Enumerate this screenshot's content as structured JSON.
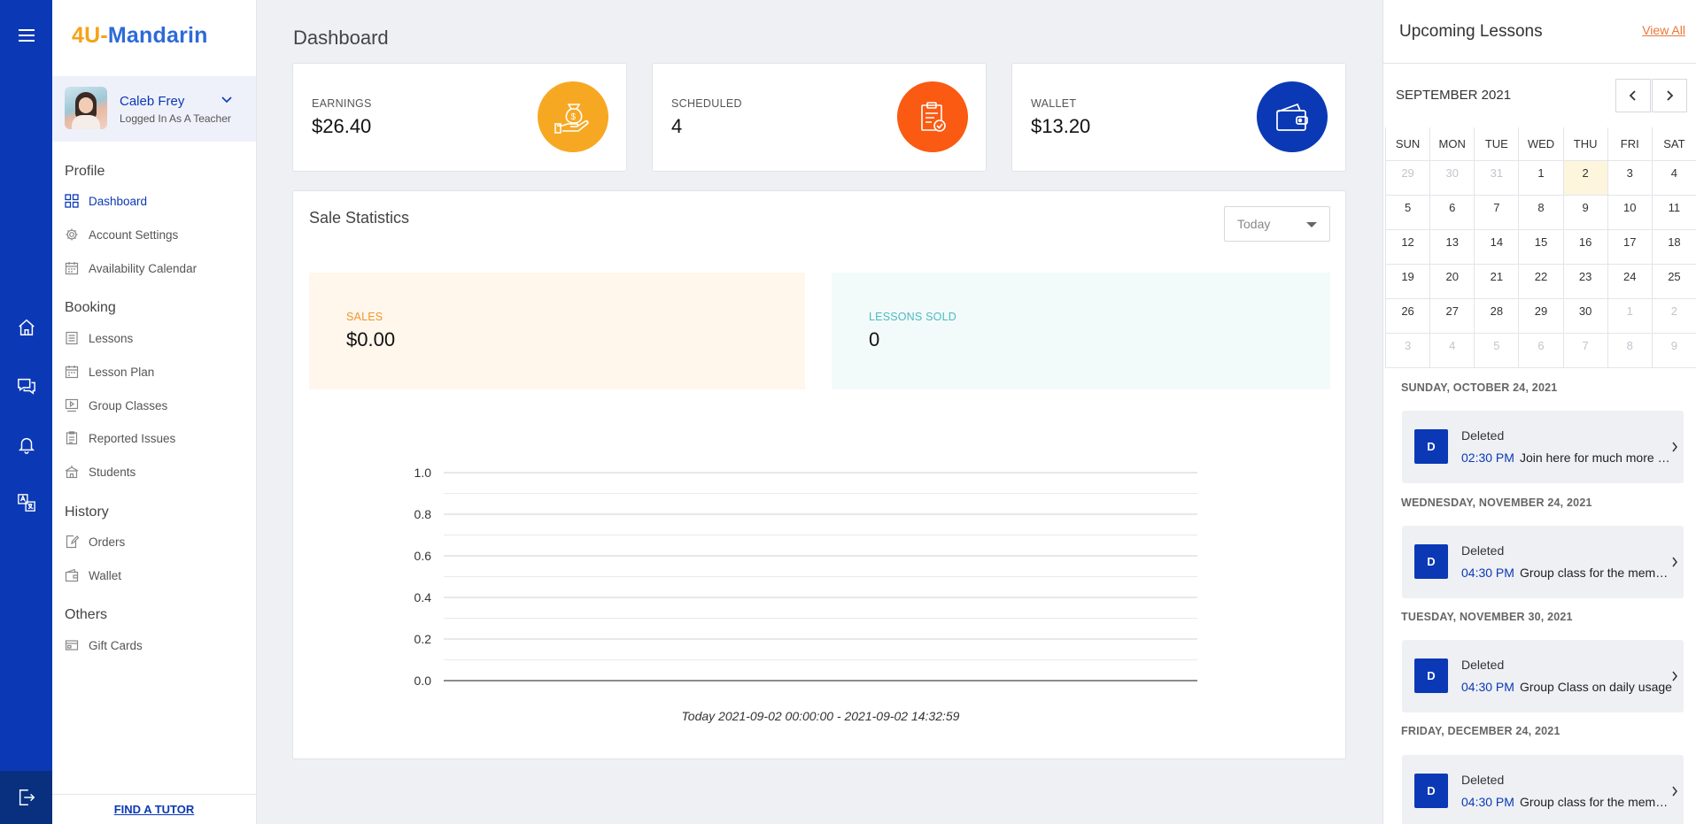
{
  "app": {
    "logo_part1": "4U-",
    "logo_part2": "Mandarin"
  },
  "user": {
    "name": "Caleb Frey",
    "role": "Logged In As A Teacher"
  },
  "sidebar": {
    "sections": [
      {
        "title": "Profile",
        "items": [
          {
            "label": "Dashboard",
            "icon": "grid-icon",
            "active": true
          },
          {
            "label": "Account Settings",
            "icon": "gear-icon"
          },
          {
            "label": "Availability Calendar",
            "icon": "calendar-icon"
          }
        ]
      },
      {
        "title": "Booking",
        "items": [
          {
            "label": "Lessons",
            "icon": "document-icon"
          },
          {
            "label": "Lesson Plan",
            "icon": "calendar-icon"
          },
          {
            "label": "Group Classes",
            "icon": "video-icon"
          },
          {
            "label": "Reported Issues",
            "icon": "report-icon"
          },
          {
            "label": "Students",
            "icon": "school-icon"
          }
        ]
      },
      {
        "title": "History",
        "items": [
          {
            "label": "Orders",
            "icon": "edit-icon"
          },
          {
            "label": "Wallet",
            "icon": "wallet-icon"
          }
        ]
      },
      {
        "title": "Others",
        "items": [
          {
            "label": "Gift Cards",
            "icon": "card-icon"
          }
        ]
      }
    ],
    "find_tutor": "FIND A TUTOR"
  },
  "page": {
    "title": "Dashboard"
  },
  "stats": [
    {
      "label": "EARNINGS",
      "value": "$26.40",
      "color": "#f7a823",
      "icon": "money-bag-icon"
    },
    {
      "label": "SCHEDULED",
      "value": "4",
      "color": "#fb5a12",
      "icon": "clipboard-icon"
    },
    {
      "label": "WALLET",
      "value": "$13.20",
      "color": "#0b39b5",
      "icon": "wallet-icon"
    }
  ],
  "sale_statistics": {
    "title": "Sale Statistics",
    "period": "Today",
    "sales_label": "SALES",
    "sales_value": "$0.00",
    "lessons_label": "LESSONS SOLD",
    "lessons_value": "0",
    "caption": "Today 2021-09-02 00:00:00 - 2021-09-02 14:32:59"
  },
  "chart_data": {
    "type": "line",
    "series": [],
    "ylim": [
      0,
      1
    ],
    "yticks": [
      "0.0",
      "0.2",
      "0.4",
      "0.6",
      "0.8",
      "1.0"
    ],
    "xlabel": "Today 2021-09-02 00:00:00 - 2021-09-02 14:32:59",
    "grid": true
  },
  "upcoming": {
    "title": "Upcoming Lessons",
    "view_all": "View All",
    "month": "SEPTEMBER 2021",
    "weekdays": [
      "SUN",
      "MON",
      "TUE",
      "WED",
      "THU",
      "FRI",
      "SAT"
    ],
    "weeks": [
      [
        "29",
        "30",
        "31",
        "1",
        "2",
        "3",
        "4"
      ],
      [
        "5",
        "6",
        "7",
        "8",
        "9",
        "10",
        "11"
      ],
      [
        "12",
        "13",
        "14",
        "15",
        "16",
        "17",
        "18"
      ],
      [
        "19",
        "20",
        "21",
        "22",
        "23",
        "24",
        "25"
      ],
      [
        "26",
        "27",
        "28",
        "29",
        "30",
        "1",
        "2"
      ],
      [
        "3",
        "4",
        "5",
        "6",
        "7",
        "8",
        "9"
      ]
    ],
    "today": "2",
    "lessons": [
      {
        "date": "SUNDAY, OCTOBER 24, 2021",
        "badge": "D",
        "status": "Deleted",
        "time": "02:30 PM",
        "name": "Join here for much more practice"
      },
      {
        "date": "WEDNESDAY, NOVEMBER 24, 2021",
        "badge": "D",
        "status": "Deleted",
        "time": "04:30 PM",
        "name": "Group class for the members"
      },
      {
        "date": "TUESDAY, NOVEMBER 30, 2021",
        "badge": "D",
        "status": "Deleted",
        "time": "04:30 PM",
        "name": "Group Class on daily usage"
      },
      {
        "date": "FRIDAY, DECEMBER 24, 2021",
        "badge": "D",
        "status": "Deleted",
        "time": "04:30 PM",
        "name": "Group class for the members"
      }
    ]
  }
}
